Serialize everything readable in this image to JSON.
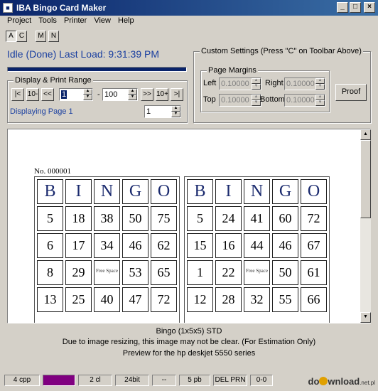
{
  "window": {
    "title": "IBA Bingo Card Maker"
  },
  "menu": [
    "Project",
    "Tools",
    "Printer",
    "View",
    "Help"
  ],
  "toolbar": {
    "buttons": [
      "A",
      "C",
      "M",
      "N"
    ]
  },
  "status": {
    "text": "Idle (Done) Last Load: 9:31:39 PM",
    "progress": 1.0
  },
  "display_range": {
    "label": "Display & Print Range",
    "buttons": [
      "|<",
      "10-",
      "<<",
      ">>",
      "10+",
      ">|"
    ],
    "from_value": "1",
    "dash": "-",
    "to_value": "100",
    "displaying_label": "Displaying Page 1",
    "page_value": "1"
  },
  "custom": {
    "label": "Custom Settings  (Press \"C\" on Toolbar Above)",
    "margins_label": "Page Margins",
    "left_label": "Left",
    "left_value": "0.10000",
    "right_label": "Right",
    "right_value": "0.10000",
    "top_label": "Top",
    "top_value": "0.10000",
    "bottom_label": "Bottom",
    "bottom_value": "0.10000",
    "proof_label": "Proof"
  },
  "preview": {
    "card_number": "No. 000001",
    "cards": [
      {
        "header": [
          "B",
          "I",
          "N",
          "G",
          "O"
        ],
        "rows": [
          [
            "5",
            "18",
            "38",
            "50",
            "75"
          ],
          [
            "6",
            "17",
            "34",
            "46",
            "62"
          ],
          [
            "8",
            "29",
            "Free Space",
            "53",
            "65"
          ],
          [
            "13",
            "25",
            "40",
            "47",
            "72"
          ]
        ]
      },
      {
        "header": [
          "B",
          "I",
          "N",
          "G",
          "O"
        ],
        "rows": [
          [
            "5",
            "24",
            "41",
            "60",
            "72"
          ],
          [
            "15",
            "16",
            "44",
            "46",
            "67"
          ],
          [
            "1",
            "22",
            "Free Space",
            "50",
            "61"
          ],
          [
            "12",
            "28",
            "32",
            "55",
            "66"
          ]
        ]
      }
    ]
  },
  "info": {
    "line1": "Bingo (1x5x5) STD",
    "line2": "Due to image resizing, this image may not be clear.  (For Estimation Only)",
    "line3": "Preview for the hp deskjet 5550 series"
  },
  "statusbar": {
    "panels": [
      "4 cpp",
      "",
      "2 cl",
      "24bit",
      "--",
      "5 pb",
      "DEL PRN",
      "0-0"
    ],
    "swatch_color": "#800080"
  },
  "watermark": {
    "text_a": "do",
    "text_b": "wnload",
    "text_c": ".net.pl"
  },
  "colors": {
    "titlebar": "#0a246a",
    "accent_text": "#1a3fa0",
    "swatch": "#800080"
  }
}
